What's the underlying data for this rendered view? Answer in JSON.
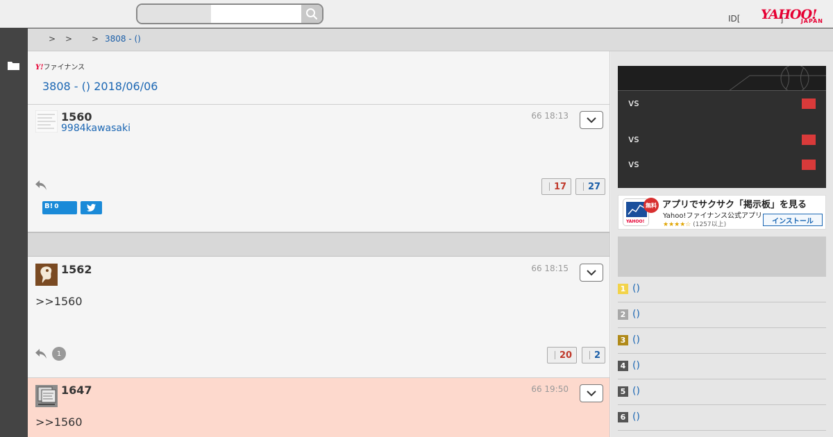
{
  "header": {
    "search_placeholder": "",
    "id_text": "ID[",
    "id_close": "]",
    "brand_main": "YAHOO!",
    "brand_sub": "JAPAN"
  },
  "breadcrumb": {
    "sep1": ">",
    "sep2": ">",
    "sep3": ">",
    "current": "3808 - ()"
  },
  "board": {
    "logo_mark": "Y!",
    "logo_text": "ファイナンス",
    "title": "3808 - () 2018/06/06"
  },
  "posts": [
    {
      "number": "1560",
      "user": "9984kawasaki",
      "date": "66 18:13",
      "body": "",
      "good": "17",
      "bad": "27",
      "hatena_label": "B!",
      "hatena_count": "0"
    },
    {
      "number": "1562",
      "date": "66 18:15",
      "body": ">>1560",
      "reply_count": "1",
      "good": "20",
      "bad": "2"
    },
    {
      "number": "1647",
      "date": "66 19:50",
      "body": ">>1560"
    }
  ],
  "sidebar": {
    "scores": [
      {
        "text": "vs"
      },
      {
        "text": "vs"
      },
      {
        "text": "vs"
      }
    ],
    "app_banner": {
      "free_badge": "無料",
      "title": "アプリでサクサク「掲示板」を見る",
      "subtitle": "Yahoo!ファイナンス公式アプリ",
      "stars": "★★★★☆",
      "rating_count": "(1257以上)",
      "install_label": "インストール",
      "icon_label": "YAHOO!"
    },
    "ranking": [
      {
        "rank": "1",
        "text": "()",
        "color": "#f2d34a"
      },
      {
        "rank": "2",
        "text": "()",
        "color": "#a8a8a8"
      },
      {
        "rank": "3",
        "text": "()",
        "color": "#b08a1a"
      },
      {
        "rank": "4",
        "text": "()",
        "color": "#555555"
      },
      {
        "rank": "5",
        "text": "()",
        "color": "#555555"
      },
      {
        "rank": "6",
        "text": "()",
        "color": "#555555"
      }
    ]
  },
  "colors": {
    "link": "#1a66b3",
    "highlight_post": "#fdd9cd",
    "brand_red": "#e60033"
  }
}
